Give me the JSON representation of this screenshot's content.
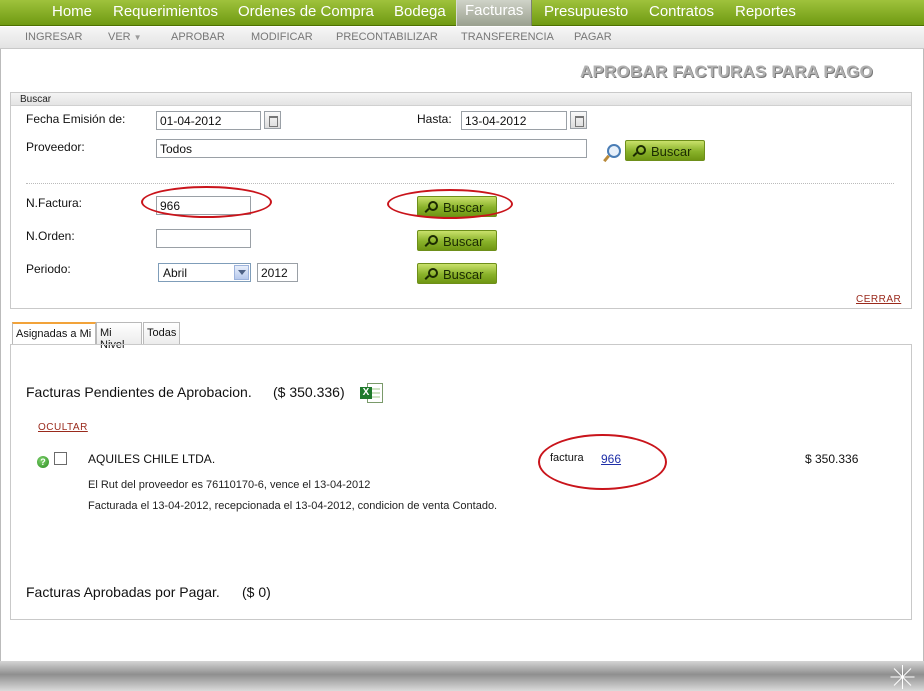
{
  "nav": {
    "items": [
      "Home",
      "Requerimientos",
      "Ordenes de Compra",
      "Bodega",
      "Facturas",
      "Presupuesto",
      "Contratos",
      "Reportes"
    ],
    "active": "Facturas"
  },
  "subnav": {
    "items": [
      "INGRESAR",
      "VER",
      "APROBAR",
      "MODIFICAR",
      "PRECONTABILIZAR",
      "TRANSFERENCIA",
      "PAGAR"
    ]
  },
  "page": {
    "title": "APROBAR FACTURAS PARA PAGO"
  },
  "search": {
    "header": "Buscar",
    "fecha_label": "Fecha Emisión de:",
    "fecha_desde": "01-04-2012",
    "hasta_label": "Hasta:",
    "fecha_hasta": "13-04-2012",
    "proveedor_label": "Proveedor:",
    "proveedor_value": "Todos",
    "button_label": "Buscar",
    "nfactura_label": "N.Factura:",
    "nfactura_value": "966",
    "norden_label": "N.Orden:",
    "norden_value": "",
    "periodo_label": "Periodo:",
    "periodo_month": "Abril",
    "periodo_year": "2012",
    "close_label": "CERRAR"
  },
  "tabs": [
    "Asignadas a Mi",
    "Mi Nivel",
    "Todas"
  ],
  "pending": {
    "title": "Facturas Pendientes de Aprobacion.",
    "amount": "($ 350.336)",
    "hide_label": "OCULTAR",
    "excel_icon": "excel-icon",
    "rows": [
      {
        "supplier": "AQUILES CHILE LTDA.",
        "doc_type": "factura",
        "doc_number": "966",
        "amount": "$ 350.336",
        "line1": "El Rut del proveedor es 76110170-6, vence el 13-04-2012",
        "line2": "Facturada el 13-04-2012, recepcionada el 13-04-2012, condicion de venta Contado."
      }
    ]
  },
  "approved": {
    "title": "Facturas Aprobadas por Pagar.",
    "amount": "($ 0)"
  },
  "colors": {
    "nav_green": "#7fa61d",
    "annotation_red": "#c9141b",
    "link_blue": "#1f2fa8"
  }
}
